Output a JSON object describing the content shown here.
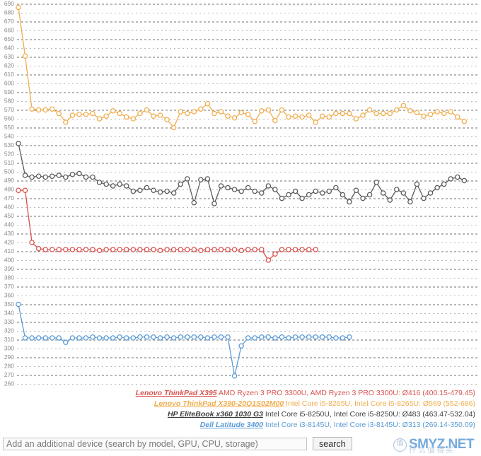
{
  "chart_data": {
    "type": "line",
    "title": "",
    "xlabel": "",
    "ylabel": "",
    "ylim": [
      260,
      690
    ],
    "ytick_step": 10,
    "yticks": [
      690,
      680,
      670,
      660,
      650,
      640,
      630,
      620,
      610,
      600,
      590,
      580,
      570,
      560,
      550,
      540,
      530,
      520,
      510,
      500,
      490,
      480,
      470,
      460,
      450,
      440,
      430,
      420,
      410,
      400,
      390,
      380,
      370,
      360,
      350,
      340,
      330,
      320,
      310,
      300,
      290,
      280,
      270,
      260
    ],
    "grid": true,
    "legend_position": "bottom-right",
    "series": [
      {
        "name": "Lenovo ThinkPad X390-20Q1S02M00",
        "color": "#f0ad4e",
        "values": [
          686,
          631,
          571,
          570,
          570,
          571,
          566,
          556,
          564,
          565,
          565,
          566,
          560,
          563,
          569,
          566,
          562,
          560,
          566,
          570,
          563,
          564,
          559,
          550,
          568,
          566,
          568,
          571,
          577,
          566,
          568,
          563,
          561,
          567,
          565,
          557,
          569,
          570,
          558,
          570,
          562,
          563,
          562,
          564,
          556,
          563,
          562,
          566,
          566,
          566,
          560,
          564,
          570,
          566,
          566,
          566,
          570,
          575,
          569,
          567,
          563,
          565,
          568,
          566,
          568,
          562,
          557
        ]
      },
      {
        "name": "HP EliteBook x360 1030 G3",
        "color": "#5a5a5a",
        "values": [
          532,
          496,
          494,
          495,
          494,
          495,
          496,
          494,
          497,
          498,
          494,
          494,
          488,
          486,
          484,
          486,
          484,
          478,
          479,
          482,
          479,
          477,
          478,
          476,
          486,
          492,
          465,
          491,
          492,
          464,
          484,
          482,
          480,
          478,
          482,
          478,
          476,
          484,
          480,
          470,
          474,
          478,
          470,
          474,
          478,
          476,
          478,
          482,
          474,
          466,
          479,
          470,
          474,
          488,
          476,
          468,
          480,
          476,
          466,
          486,
          470,
          476,
          482,
          486,
          492,
          494,
          490
        ]
      },
      {
        "name": "Lenovo ThinkPad X395",
        "color": "#d9534f",
        "values": [
          479,
          479,
          420,
          413,
          412,
          412,
          412,
          412,
          412,
          412,
          412,
          412,
          411,
          412,
          412,
          412,
          412,
          412,
          412,
          412,
          412,
          411,
          412,
          412,
          412,
          412,
          412,
          411,
          412,
          412,
          412,
          412,
          412,
          411,
          412,
          412,
          412,
          400,
          407,
          412,
          412,
          412,
          412,
          412,
          412
        ]
      },
      {
        "name": "Dell Latitude 3400",
        "color": "#5b9bd5",
        "values": [
          350,
          312,
          312,
          312,
          312,
          312,
          312,
          307,
          312,
          312,
          312,
          313,
          312,
          312,
          312,
          313,
          312,
          312,
          313,
          313,
          313,
          312,
          313,
          312,
          313,
          313,
          313,
          313,
          312,
          313,
          313,
          313,
          269,
          303,
          312,
          312,
          313,
          313,
          312,
          313,
          312,
          313,
          313,
          313,
          313,
          313,
          313,
          312,
          312,
          313
        ]
      }
    ]
  },
  "legend": {
    "rows": [
      {
        "color_key": "c-red",
        "name": "Lenovo ThinkPad X395",
        "rest": " AMD Ryzen 3 PRO 3300U, AMD Ryzen 3 PRO 3300U: Ø416 (400.15-479.45)"
      },
      {
        "color_key": "c-orange",
        "name": "Lenovo ThinkPad X390-20Q1S02M00",
        "rest": " Intel Core i5-8265U, Intel Core i5-8265U: Ø569 (552-686)"
      },
      {
        "color_key": "c-gray",
        "name": "HP EliteBook x360 1030 G3",
        "rest": " Intel Core i5-8250U, Intel Core i5-8250U: Ø483 (463.47-532.04)"
      },
      {
        "color_key": "c-blue",
        "name": "Dell Latitude 3400",
        "rest": " Intel Core i3-8145U, Intel Core i3-8145U: Ø313 (269.14-350.09)"
      }
    ]
  },
  "search": {
    "placeholder": "Add an additional device (search by model, GPU, CPU, storage)",
    "value": "",
    "button_label": "search"
  },
  "watermark": {
    "badge_glyph": "值",
    "text": "SMYZ.NET",
    "subtext": "什么值得买"
  },
  "colors": {
    "orange": "#f0ad4e",
    "gray": "#5a5a5a",
    "red": "#d9534f",
    "blue": "#5b9bd5",
    "gridline": "#6f6f6f",
    "tick_label": "#8a8a8a"
  }
}
